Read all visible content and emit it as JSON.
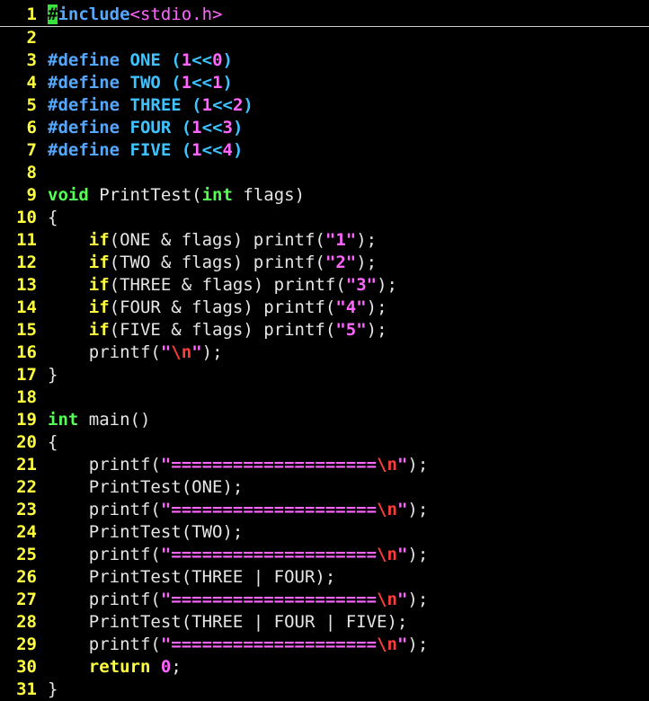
{
  "colors": {
    "background": "#000000",
    "line_number": "#ffff3c",
    "preprocessor": "#55a8ff",
    "macro_value": "#3fc3ff",
    "number": "#ff66ff",
    "string": "#ff66ff",
    "escape": "#ff3b3b",
    "type": "#55ff55",
    "keyword": "#ffff3c",
    "text": "#e6e6e6",
    "cursor": "#37e33a"
  },
  "editor": {
    "cursor_line": 1,
    "lines": [
      {
        "n": "1",
        "tokens": [
          {
            "t": "#",
            "k": "cursor"
          },
          {
            "t": "include",
            "k": "preproc"
          },
          {
            "t": "<stdio.h>",
            "k": "include"
          }
        ]
      },
      {
        "n": "2",
        "tokens": []
      },
      {
        "n": "3",
        "tokens": [
          {
            "t": "#define ",
            "k": "preproc"
          },
          {
            "t": "ONE ",
            "k": "macro"
          },
          {
            "t": "(",
            "k": "macro"
          },
          {
            "t": "1",
            "k": "number"
          },
          {
            "t": "<<",
            "k": "macro"
          },
          {
            "t": "0",
            "k": "number"
          },
          {
            "t": ")",
            "k": "macro"
          }
        ]
      },
      {
        "n": "4",
        "tokens": [
          {
            "t": "#define ",
            "k": "preproc"
          },
          {
            "t": "TWO ",
            "k": "macro"
          },
          {
            "t": "(",
            "k": "macro"
          },
          {
            "t": "1",
            "k": "number"
          },
          {
            "t": "<<",
            "k": "macro"
          },
          {
            "t": "1",
            "k": "number"
          },
          {
            "t": ")",
            "k": "macro"
          }
        ]
      },
      {
        "n": "5",
        "tokens": [
          {
            "t": "#define ",
            "k": "preproc"
          },
          {
            "t": "THREE ",
            "k": "macro"
          },
          {
            "t": "(",
            "k": "macro"
          },
          {
            "t": "1",
            "k": "number"
          },
          {
            "t": "<<",
            "k": "macro"
          },
          {
            "t": "2",
            "k": "number"
          },
          {
            "t": ")",
            "k": "macro"
          }
        ]
      },
      {
        "n": "6",
        "tokens": [
          {
            "t": "#define ",
            "k": "preproc"
          },
          {
            "t": "FOUR ",
            "k": "macro"
          },
          {
            "t": "(",
            "k": "macro"
          },
          {
            "t": "1",
            "k": "number"
          },
          {
            "t": "<<",
            "k": "macro"
          },
          {
            "t": "3",
            "k": "number"
          },
          {
            "t": ")",
            "k": "macro"
          }
        ]
      },
      {
        "n": "7",
        "tokens": [
          {
            "t": "#define ",
            "k": "preproc"
          },
          {
            "t": "FIVE ",
            "k": "macro"
          },
          {
            "t": "(",
            "k": "macro"
          },
          {
            "t": "1",
            "k": "number"
          },
          {
            "t": "<<",
            "k": "macro"
          },
          {
            "t": "4",
            "k": "number"
          },
          {
            "t": ")",
            "k": "macro"
          }
        ]
      },
      {
        "n": "8",
        "tokens": []
      },
      {
        "n": "9",
        "tokens": [
          {
            "t": "void",
            "k": "type"
          },
          {
            "t": " PrintTest(",
            "k": "text"
          },
          {
            "t": "int",
            "k": "type"
          },
          {
            "t": " flags)",
            "k": "text"
          }
        ]
      },
      {
        "n": "10",
        "tokens": [
          {
            "t": "{",
            "k": "text"
          }
        ]
      },
      {
        "n": "11",
        "tokens": [
          {
            "t": "    ",
            "k": "text"
          },
          {
            "t": "if",
            "k": "keyword"
          },
          {
            "t": "(ONE & flags) printf(",
            "k": "text"
          },
          {
            "t": "\"1\"",
            "k": "string"
          },
          {
            "t": ");",
            "k": "text"
          }
        ]
      },
      {
        "n": "12",
        "tokens": [
          {
            "t": "    ",
            "k": "text"
          },
          {
            "t": "if",
            "k": "keyword"
          },
          {
            "t": "(TWO & flags) printf(",
            "k": "text"
          },
          {
            "t": "\"2\"",
            "k": "string"
          },
          {
            "t": ");",
            "k": "text"
          }
        ]
      },
      {
        "n": "13",
        "tokens": [
          {
            "t": "    ",
            "k": "text"
          },
          {
            "t": "if",
            "k": "keyword"
          },
          {
            "t": "(THREE & flags) printf(",
            "k": "text"
          },
          {
            "t": "\"3\"",
            "k": "string"
          },
          {
            "t": ");",
            "k": "text"
          }
        ]
      },
      {
        "n": "14",
        "tokens": [
          {
            "t": "    ",
            "k": "text"
          },
          {
            "t": "if",
            "k": "keyword"
          },
          {
            "t": "(FOUR & flags) printf(",
            "k": "text"
          },
          {
            "t": "\"4\"",
            "k": "string"
          },
          {
            "t": ");",
            "k": "text"
          }
        ]
      },
      {
        "n": "15",
        "tokens": [
          {
            "t": "    ",
            "k": "text"
          },
          {
            "t": "if",
            "k": "keyword"
          },
          {
            "t": "(FIVE & flags) printf(",
            "k": "text"
          },
          {
            "t": "\"5\"",
            "k": "string"
          },
          {
            "t": ");",
            "k": "text"
          }
        ]
      },
      {
        "n": "16",
        "tokens": [
          {
            "t": "    printf(",
            "k": "text"
          },
          {
            "t": "\"",
            "k": "string"
          },
          {
            "t": "\\n",
            "k": "escape"
          },
          {
            "t": "\"",
            "k": "string"
          },
          {
            "t": ");",
            "k": "text"
          }
        ]
      },
      {
        "n": "17",
        "tokens": [
          {
            "t": "}",
            "k": "text"
          }
        ]
      },
      {
        "n": "18",
        "tokens": []
      },
      {
        "n": "19",
        "tokens": [
          {
            "t": "int",
            "k": "type"
          },
          {
            "t": " main()",
            "k": "text"
          }
        ]
      },
      {
        "n": "20",
        "tokens": [
          {
            "t": "{",
            "k": "text"
          }
        ]
      },
      {
        "n": "21",
        "tokens": [
          {
            "t": "    printf(",
            "k": "text"
          },
          {
            "t": "\"====================",
            "k": "string"
          },
          {
            "t": "\\n",
            "k": "escape"
          },
          {
            "t": "\"",
            "k": "string"
          },
          {
            "t": ");",
            "k": "text"
          }
        ]
      },
      {
        "n": "22",
        "tokens": [
          {
            "t": "    PrintTest(ONE);",
            "k": "text"
          }
        ]
      },
      {
        "n": "23",
        "tokens": [
          {
            "t": "    printf(",
            "k": "text"
          },
          {
            "t": "\"====================",
            "k": "string"
          },
          {
            "t": "\\n",
            "k": "escape"
          },
          {
            "t": "\"",
            "k": "string"
          },
          {
            "t": ");",
            "k": "text"
          }
        ]
      },
      {
        "n": "24",
        "tokens": [
          {
            "t": "    PrintTest(TWO);",
            "k": "text"
          }
        ]
      },
      {
        "n": "25",
        "tokens": [
          {
            "t": "    printf(",
            "k": "text"
          },
          {
            "t": "\"====================",
            "k": "string"
          },
          {
            "t": "\\n",
            "k": "escape"
          },
          {
            "t": "\"",
            "k": "string"
          },
          {
            "t": ");",
            "k": "text"
          }
        ]
      },
      {
        "n": "26",
        "tokens": [
          {
            "t": "    PrintTest(THREE | FOUR);",
            "k": "text"
          }
        ]
      },
      {
        "n": "27",
        "tokens": [
          {
            "t": "    printf(",
            "k": "text"
          },
          {
            "t": "\"====================",
            "k": "string"
          },
          {
            "t": "\\n",
            "k": "escape"
          },
          {
            "t": "\"",
            "k": "string"
          },
          {
            "t": ");",
            "k": "text"
          }
        ]
      },
      {
        "n": "28",
        "tokens": [
          {
            "t": "    PrintTest(THREE | FOUR | FIVE);",
            "k": "text"
          }
        ]
      },
      {
        "n": "29",
        "tokens": [
          {
            "t": "    printf(",
            "k": "text"
          },
          {
            "t": "\"====================",
            "k": "string"
          },
          {
            "t": "\\n",
            "k": "escape"
          },
          {
            "t": "\"",
            "k": "string"
          },
          {
            "t": ");",
            "k": "text"
          }
        ]
      },
      {
        "n": "30",
        "tokens": [
          {
            "t": "    ",
            "k": "text"
          },
          {
            "t": "return",
            "k": "keyword"
          },
          {
            "t": " ",
            "k": "text"
          },
          {
            "t": "0",
            "k": "number"
          },
          {
            "t": ";",
            "k": "text"
          }
        ]
      },
      {
        "n": "31",
        "tokens": [
          {
            "t": "}",
            "k": "text"
          }
        ]
      }
    ]
  }
}
